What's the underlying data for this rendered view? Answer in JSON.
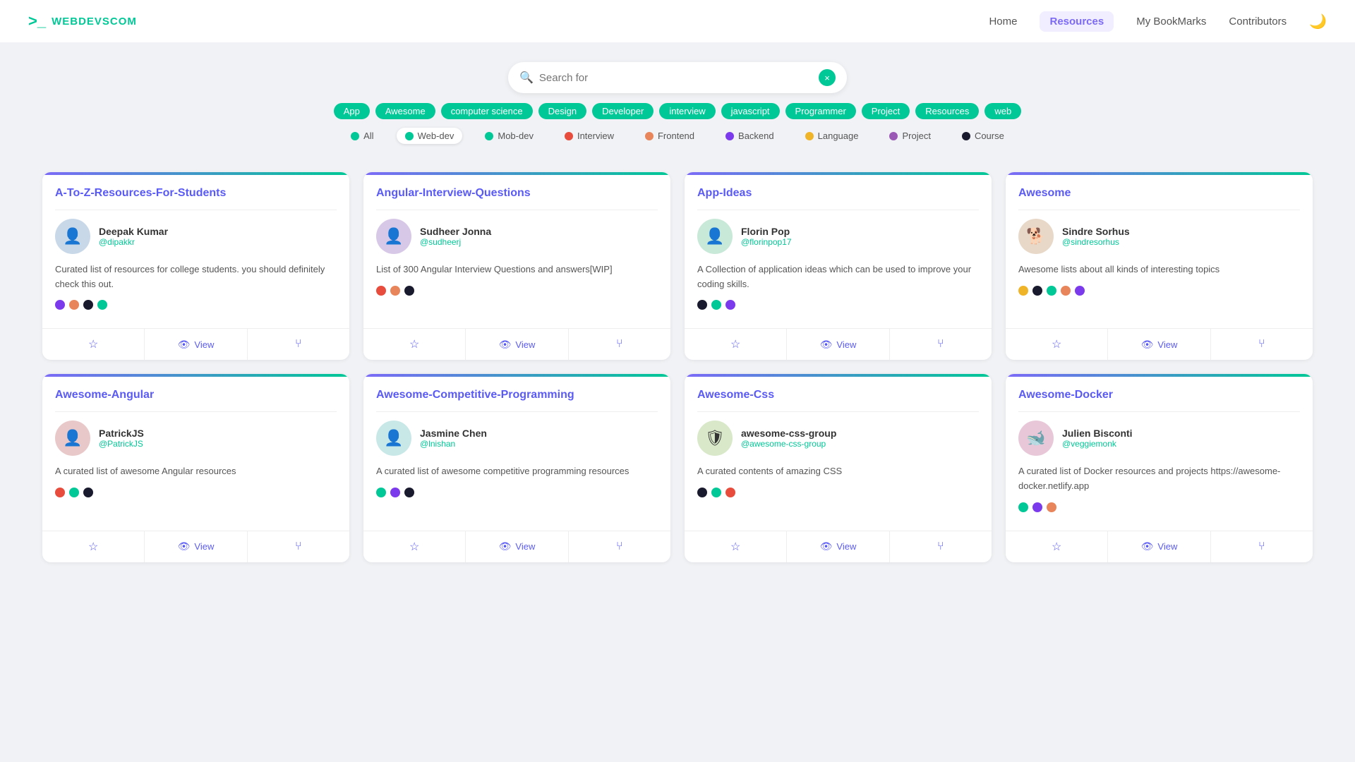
{
  "header": {
    "logo_icon": ">_",
    "logo_text": "WEBDEVSCOM",
    "nav": [
      {
        "label": "Home",
        "active": false
      },
      {
        "label": "Resources",
        "active": true
      },
      {
        "label": "My BookMarks",
        "active": false
      },
      {
        "label": "Contributors",
        "active": false
      }
    ],
    "moon_icon": "🌙"
  },
  "search": {
    "placeholder": "Search for",
    "clear_icon": "×"
  },
  "tags": [
    "App",
    "Awesome",
    "computer science",
    "Design",
    "Developer",
    "interview",
    "javascript",
    "Programmer",
    "Project",
    "Resources",
    "web"
  ],
  "filters": [
    {
      "label": "All",
      "color": "#00c896",
      "active": false
    },
    {
      "label": "Web-dev",
      "color": "#00c896",
      "active": true
    },
    {
      "label": "Mob-dev",
      "color": "#00c896",
      "active": false
    },
    {
      "label": "Interview",
      "color": "#e74c3c",
      "active": false
    },
    {
      "label": "Frontend",
      "color": "#e8855a",
      "active": false
    },
    {
      "label": "Backend",
      "color": "#7c3aed",
      "active": false
    },
    {
      "label": "Language",
      "color": "#f0b429",
      "active": false
    },
    {
      "label": "Project",
      "color": "#9b59b6",
      "active": false
    },
    {
      "label": "Course",
      "color": "#1a1a2e",
      "active": false
    }
  ],
  "cards": [
    {
      "title": "A-To-Z-Resources-For-Students",
      "author_name": "Deepak Kumar",
      "author_handle": "@dipakkr",
      "author_emoji": "👤",
      "description": "Curated list of resources for college students. you should definitely check this out.",
      "dots": [
        "#7c3aed",
        "#e8855a",
        "#1a1a2e",
        "#00c896"
      ]
    },
    {
      "title": "Angular-Interview-Questions",
      "author_name": "Sudheer Jonna",
      "author_handle": "@sudheerj",
      "author_emoji": "👤",
      "description": "List of 300 Angular Interview Questions and answers[WIP]",
      "dots": [
        "#e74c3c",
        "#e8855a",
        "#1a1a2e"
      ]
    },
    {
      "title": "App-Ideas",
      "author_name": "Florin Pop",
      "author_handle": "@florinpop17",
      "author_emoji": "👤",
      "description": "A Collection of application ideas which can be used to improve your coding skills.",
      "dots": [
        "#1a1a2e",
        "#00c896",
        "#7c3aed"
      ]
    },
    {
      "title": "Awesome",
      "author_name": "Sindre Sorhus",
      "author_handle": "@sindresorhus",
      "author_emoji": "🐕",
      "description": "Awesome lists about all kinds of interesting topics",
      "dots": [
        "#f0b429",
        "#1a1a2e",
        "#00c896",
        "#e8855a",
        "#7c3aed"
      ]
    },
    {
      "title": "Awesome-Angular",
      "author_name": "PatrickJS",
      "author_handle": "@PatrickJS",
      "author_emoji": "👤",
      "description": "A curated list of awesome Angular resources",
      "dots": [
        "#e74c3c",
        "#00c896",
        "#1a1a2e"
      ]
    },
    {
      "title": "Awesome-Competitive-Programming",
      "author_name": "Jasmine Chen",
      "author_handle": "@lnishan",
      "author_emoji": "👤",
      "description": "A curated list of awesome competitive programming resources",
      "dots": [
        "#00c896",
        "#7c3aed",
        "#1a1a2e"
      ]
    },
    {
      "title": "Awesome-Css",
      "author_name": "awesome-css-group",
      "author_handle": "@awesome-css-group",
      "author_emoji": "🛡",
      "description": "A curated contents of amazing CSS",
      "dots": [
        "#1a1a2e",
        "#00c896",
        "#e74c3c"
      ]
    },
    {
      "title": "Awesome-Docker",
      "author_name": "Julien Bisconti",
      "author_handle": "@veggiemonk",
      "author_emoji": "🐋",
      "description": "A curated list of Docker resources and projects https://awesome-docker.netlify.app",
      "dots": [
        "#00c896",
        "#7c3aed",
        "#e8855a"
      ]
    }
  ],
  "card_actions": {
    "view_label": "View"
  }
}
